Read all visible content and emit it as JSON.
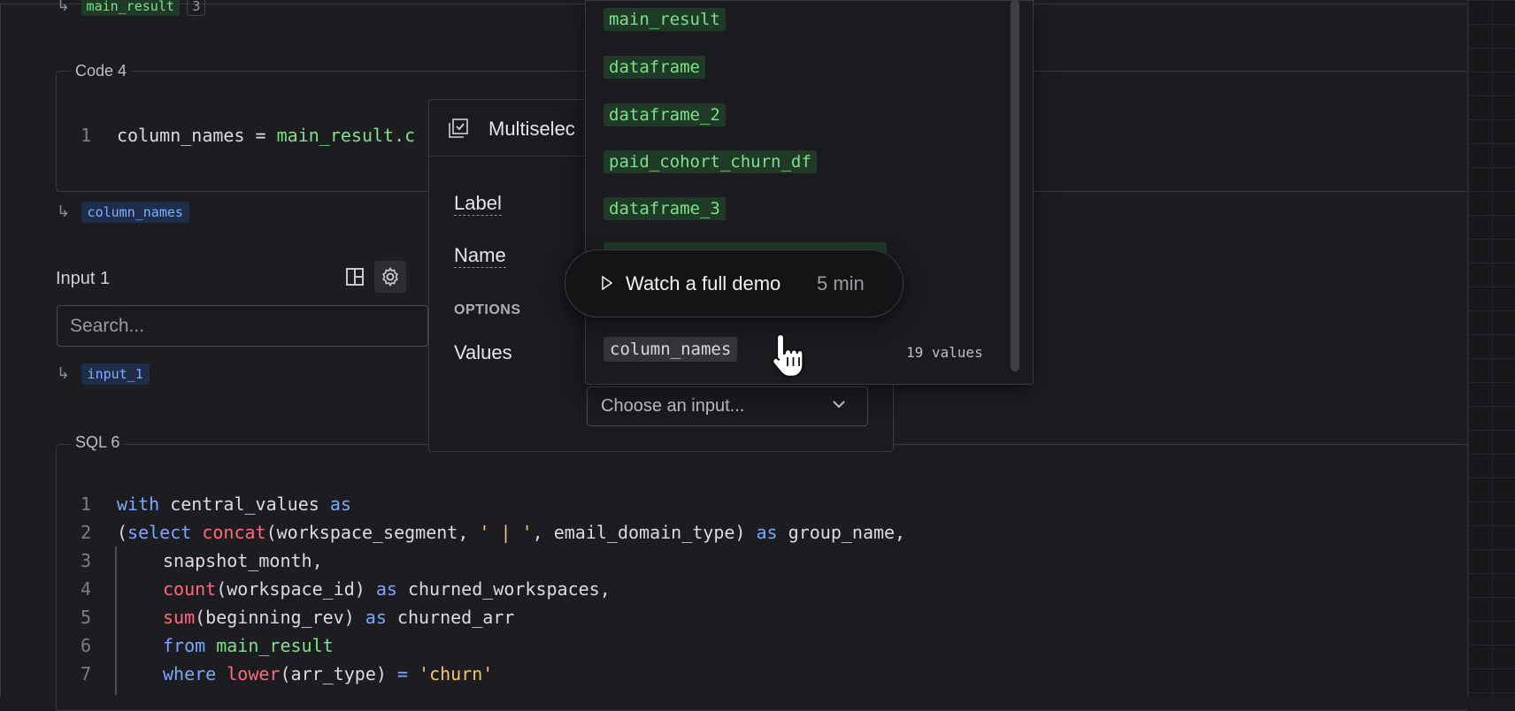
{
  "top_output": {
    "pill": "main_result",
    "count": "3"
  },
  "code4": {
    "title": "Code 4",
    "line_number": "1",
    "var": "column_names",
    "op": " = ",
    "rhs": "main_result.c",
    "output": "column_names"
  },
  "input1": {
    "title": "Input 1",
    "search_placeholder": "Search...",
    "output": "input_1"
  },
  "settings": {
    "header_title": "Multiselec",
    "label": "Label",
    "name": "Name",
    "options_header": "OPTIONS",
    "values": "Values",
    "select_placeholder": "Choose an input..."
  },
  "dropdown": {
    "items": [
      "main_result",
      "dataframe",
      "dataframe_2",
      "paid_cohort_churn_df",
      "dataframe_3"
    ],
    "selected": "column_names",
    "selected_count": "19 values"
  },
  "demo": {
    "label": "Watch a full demo",
    "duration": "5 min"
  },
  "sql6": {
    "title": "SQL 6",
    "line_numbers": [
      "1",
      "2",
      "3",
      "4",
      "5",
      "6",
      "7"
    ],
    "l1": {
      "a": "with",
      "b": " central_values ",
      "c": "as"
    },
    "l2": {
      "a": "(",
      "b": "select",
      "c": " ",
      "d": "concat",
      "e": "(workspace_segment, ",
      "f": "' | '",
      "g": ", email_domain_type) ",
      "h": "as",
      "i": " group_name,"
    },
    "l3": {
      "a": "snapshot_month,"
    },
    "l4": {
      "a": "count",
      "b": "(workspace_id) ",
      "c": "as",
      "d": " churned_workspaces,"
    },
    "l5": {
      "a": "sum",
      "b": "(beginning_rev) ",
      "c": "as",
      "d": " churned_arr"
    },
    "l6": {
      "a": "from",
      "b": " ",
      "c": "main_result"
    },
    "l7": {
      "a": "where",
      "b": " ",
      "c": "lower",
      "d": "(arr_type) ",
      "e": "=",
      "f": " ",
      "g": "'churn'"
    }
  }
}
